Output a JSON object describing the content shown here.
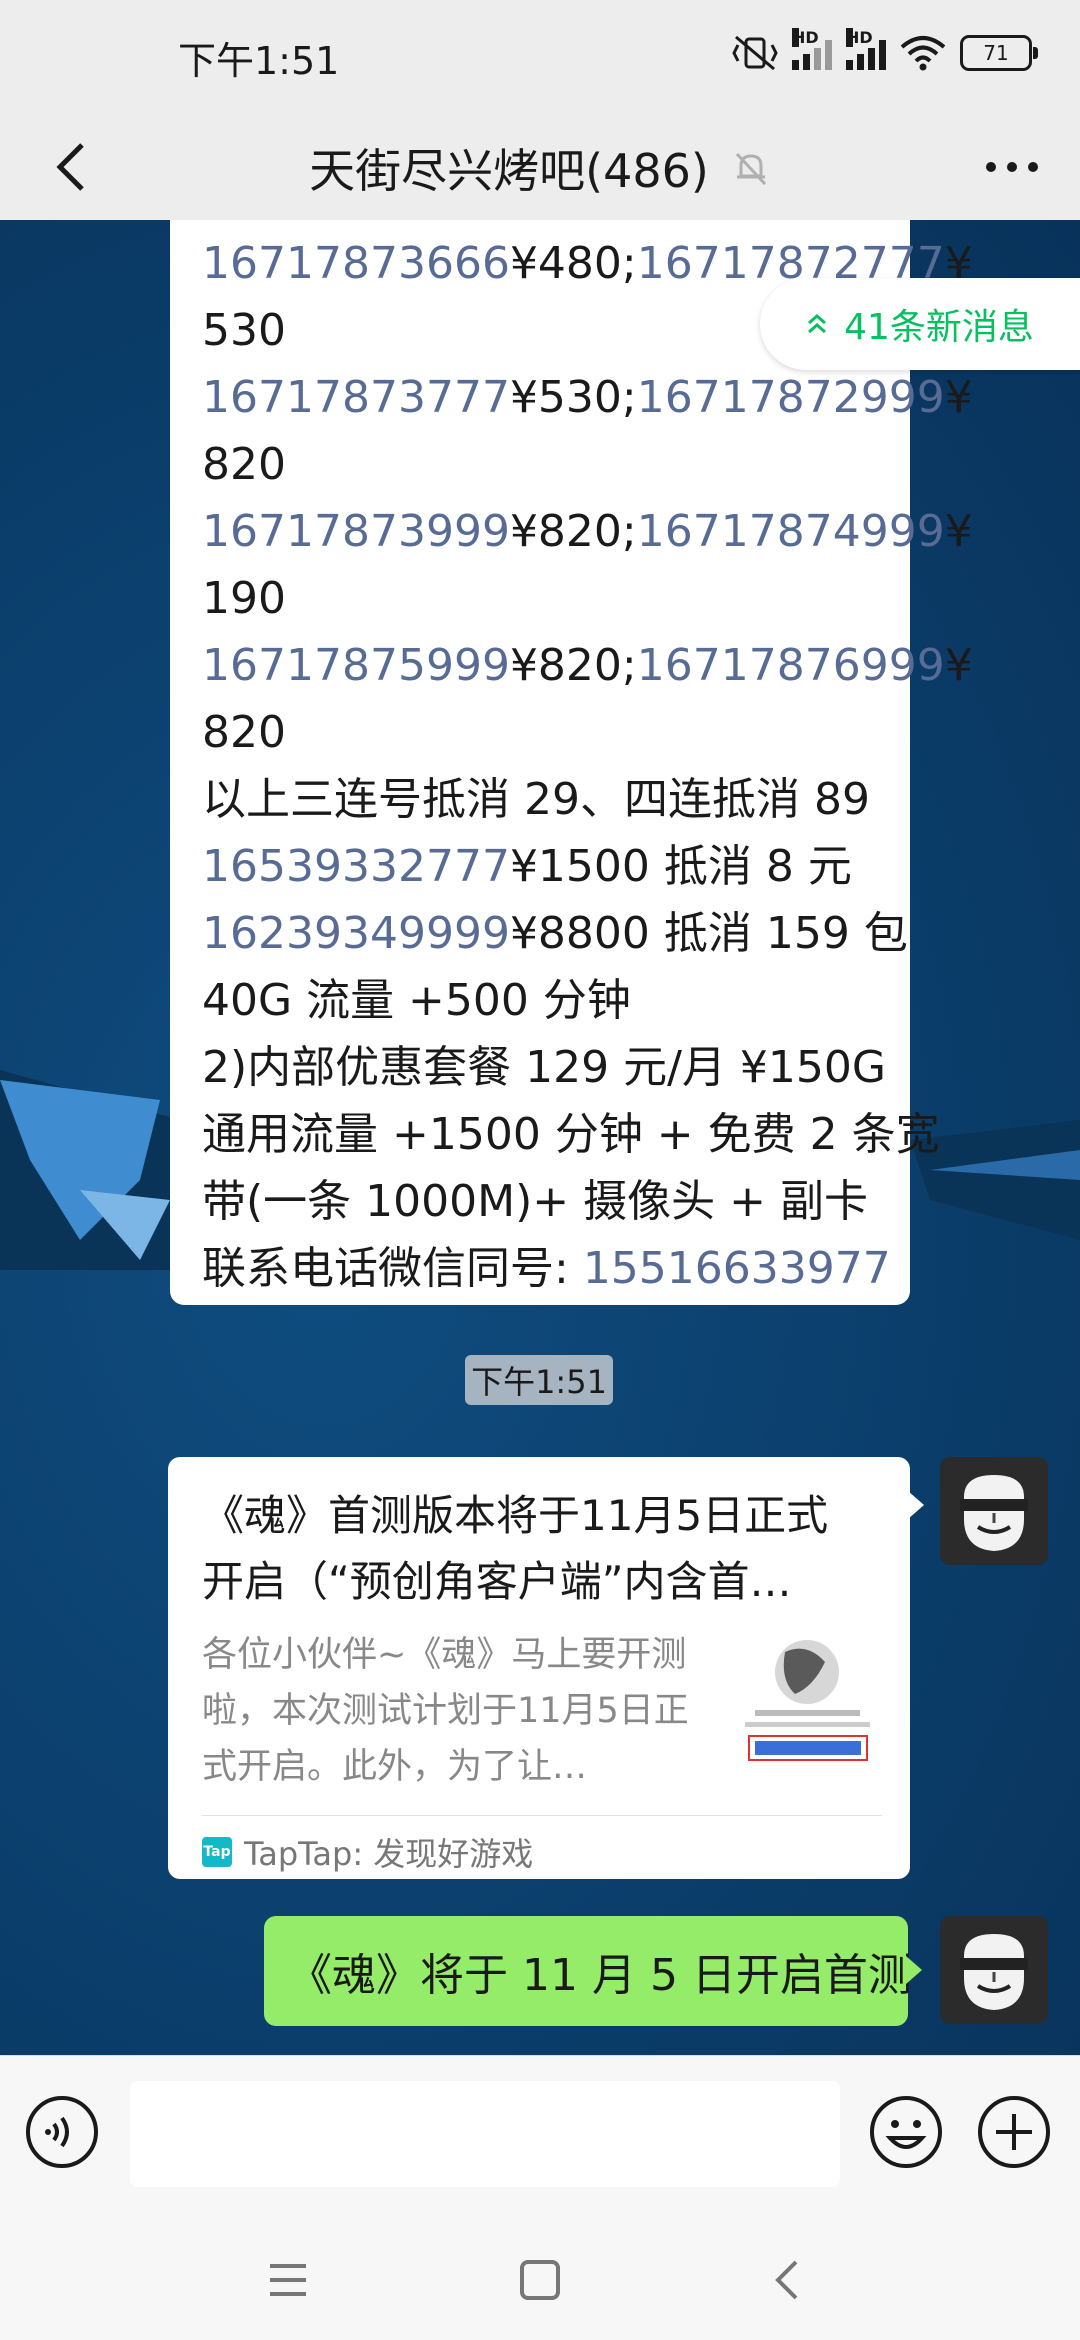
{
  "status_bar": {
    "time": "下午1:51",
    "hd1": "HD",
    "hd2": "HD",
    "battery": "71"
  },
  "header": {
    "title": "天街尽兴烤吧(486)"
  },
  "new_messages": {
    "label": "41条新消息"
  },
  "big_message": {
    "lines": [
      [
        {
          "t": "16717873666",
          "n": true
        },
        {
          "t": "¥480;",
          "n": false
        },
        {
          "t": "16717872777",
          "n": true
        },
        {
          "t": "¥",
          "n": false
        }
      ],
      [
        {
          "t": "530",
          "n": false
        }
      ],
      [
        {
          "t": "16717873777",
          "n": true
        },
        {
          "t": "¥530;",
          "n": false
        },
        {
          "t": "16717872999",
          "n": true
        },
        {
          "t": "¥",
          "n": false
        }
      ],
      [
        {
          "t": "820",
          "n": false
        }
      ],
      [
        {
          "t": "16717873999",
          "n": true
        },
        {
          "t": "¥820;",
          "n": false
        },
        {
          "t": "16717874999",
          "n": true
        },
        {
          "t": "¥",
          "n": false
        }
      ],
      [
        {
          "t": "190",
          "n": false
        }
      ],
      [
        {
          "t": "16717875999",
          "n": true
        },
        {
          "t": "¥820;",
          "n": false
        },
        {
          "t": "16717876999",
          "n": true
        },
        {
          "t": "¥",
          "n": false
        }
      ],
      [
        {
          "t": "820",
          "n": false
        }
      ],
      [
        {
          "t": "以上三连号抵消 29、四连抵消 89",
          "n": false
        }
      ],
      [
        {
          "t": "16539332777",
          "n": true
        },
        {
          "t": "¥1500 抵消 8 元",
          "n": false
        }
      ],
      [
        {
          "t": "16239349999",
          "n": true
        },
        {
          "t": "¥8800 抵消 159 包",
          "n": false
        }
      ],
      [
        {
          "t": "40G 流量 +500 分钟",
          "n": false
        }
      ],
      [
        {
          "t": "2)内部优惠套餐 129 元/月 ¥150G",
          "n": false
        }
      ],
      [
        {
          "t": "通用流量 +1500 分钟 + 免费 2 条宽",
          "n": false
        }
      ],
      [
        {
          "t": "带(一条 1000M)+ 摄像头 + 副卡",
          "n": false
        }
      ],
      [
        {
          "t": "联系电话微信同号: ",
          "n": false
        },
        {
          "t": "15516633977",
          "n": true
        }
      ]
    ]
  },
  "timestamp": "下午1:51",
  "link_card": {
    "title_line1": "《魂》首测版本将于11月5日正式",
    "title_line2": "开启（“预创角客户端”内含首…",
    "desc": "各位小伙伴~《魂》马上要开测啦，本次测试计划于11月5日正式开启。此外，为了让…",
    "source": "TapTap: 发现好游戏",
    "source_logo": "Tap"
  },
  "green_message": "《魂》将于 11 月 5 日开启首测",
  "input": {
    "value": ""
  },
  "colors": {
    "link": "#576b95",
    "green": "#07c160",
    "bubble_green": "#95ec69"
  }
}
